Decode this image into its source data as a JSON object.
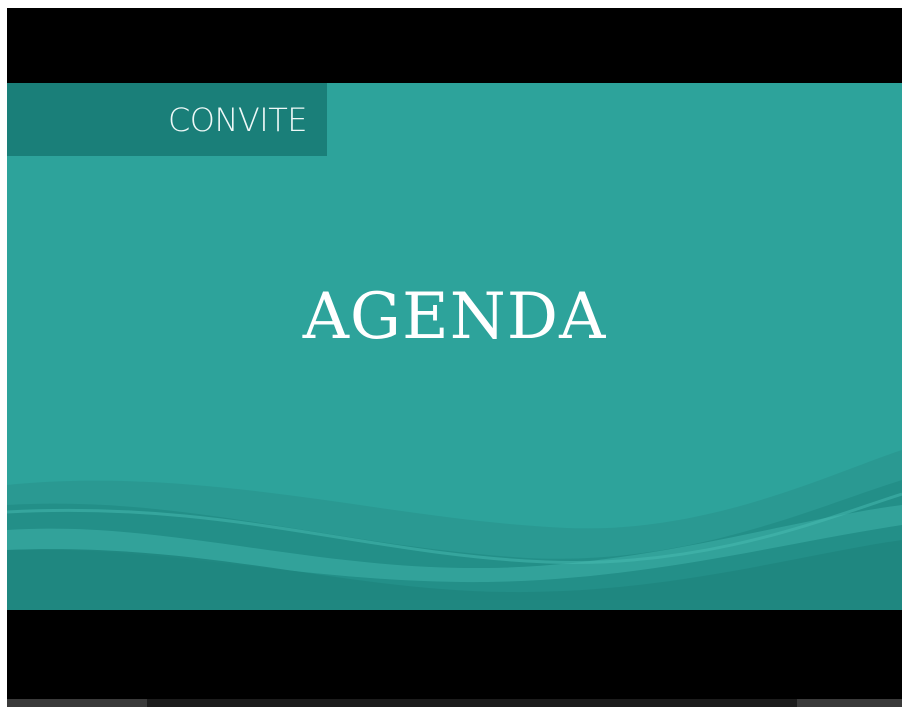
{
  "slide": {
    "tag": "CONVITE",
    "title": "AGENDA"
  },
  "colors": {
    "background": "#2da39b",
    "tag_box": "#1a7f79",
    "title_text": "#ffffff",
    "letterbox": "#000000"
  }
}
